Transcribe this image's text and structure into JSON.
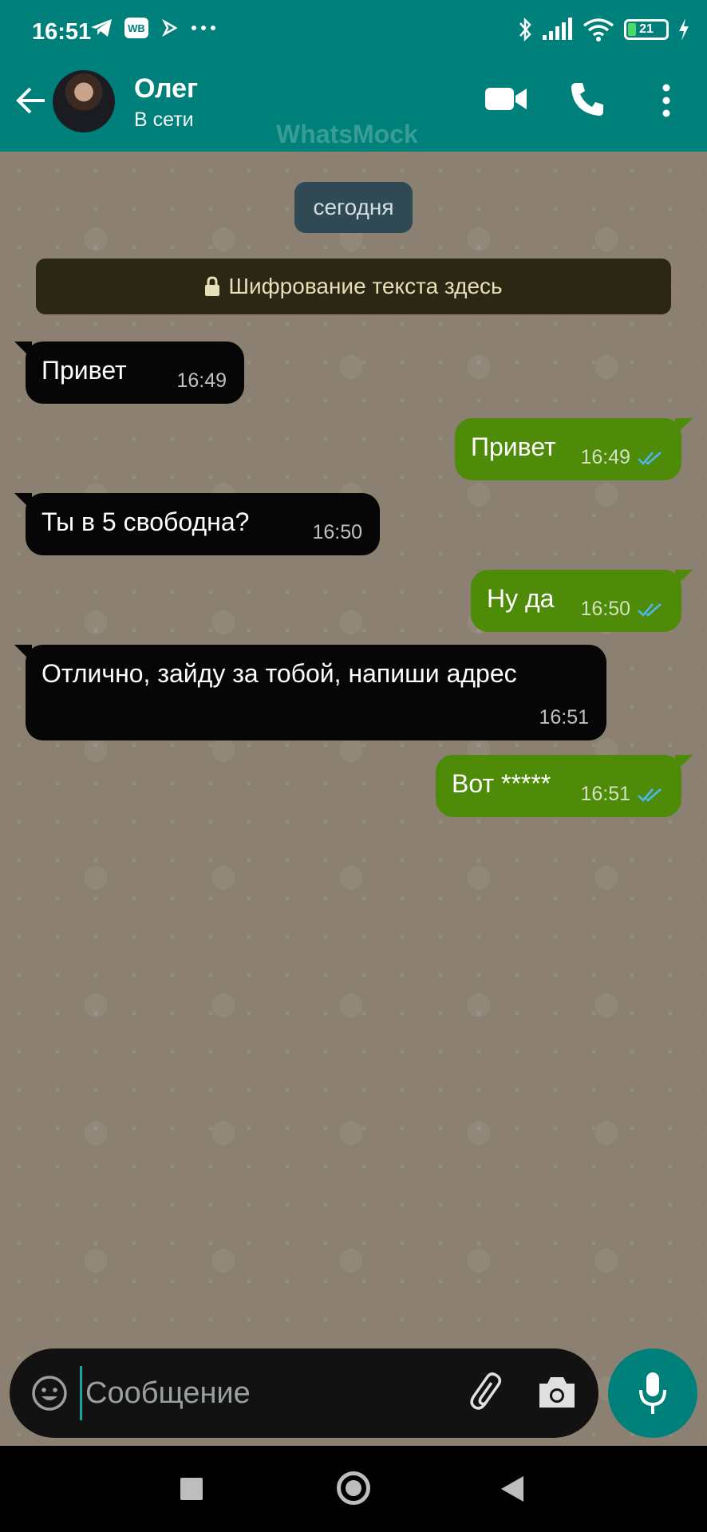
{
  "status_bar": {
    "time": "16:51",
    "left_icons": [
      "telegram-icon",
      "wb-icon",
      "play-icon",
      "more-notifications-icon"
    ],
    "wb_label": "WB",
    "right_icons": [
      "bluetooth-icon",
      "signal-icon",
      "wifi-icon",
      "battery-icon",
      "charging-icon"
    ],
    "battery_level": "21"
  },
  "header": {
    "contact_name": "Олег",
    "contact_status": "В сети",
    "watermark": "WhatsMock",
    "icons": [
      "back-arrow-icon",
      "avatar",
      "video-call-icon",
      "phone-call-icon",
      "more-vert-icon"
    ]
  },
  "chat": {
    "date_chip": "сегодня",
    "encryption_banner": "Шифрование текста здесь",
    "messages": [
      {
        "direction": "in",
        "text": "Привет",
        "time": "16:49"
      },
      {
        "direction": "out",
        "text": "Привет",
        "time": "16:49",
        "status": "read"
      },
      {
        "direction": "in",
        "text": "Ты в 5 свободна?",
        "time": "16:50"
      },
      {
        "direction": "out",
        "text": "Ну да",
        "time": "16:50",
        "status": "read"
      },
      {
        "direction": "in",
        "text": "Отлично, зайду за тобой, напиши адрес",
        "time": "16:51"
      },
      {
        "direction": "out",
        "text": "Вот *****",
        "time": "16:51",
        "status": "read"
      }
    ]
  },
  "composer": {
    "placeholder": "Сообщение",
    "value": "",
    "icons": [
      "emoji-icon",
      "attach-icon",
      "camera-icon",
      "mic-icon"
    ]
  },
  "colors": {
    "header": "#00807a",
    "incoming_bubble": "#060606",
    "outgoing_bubble": "#4d8b09",
    "read_ticks": "#4fb6ec",
    "chat_background": "#8b8071"
  }
}
